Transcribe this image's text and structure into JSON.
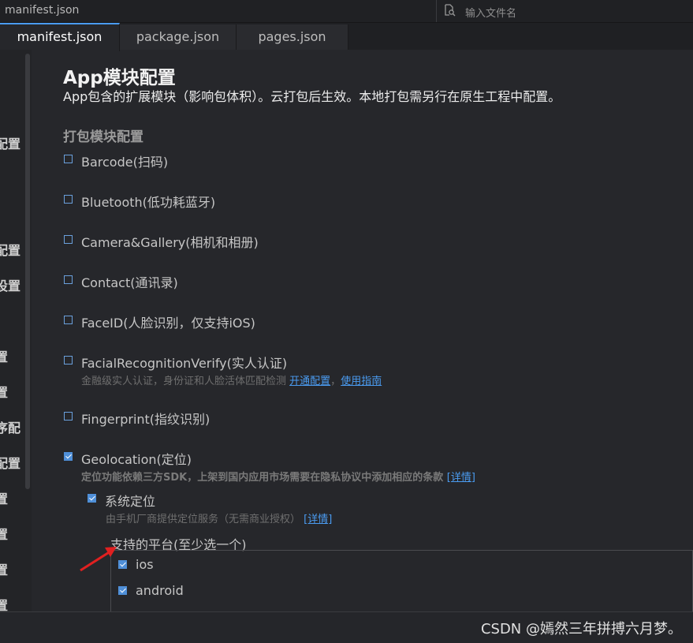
{
  "window": {
    "filename": "manifest.json",
    "search_placeholder": "输入文件名",
    "search_icon": "file-search-icon"
  },
  "tabs": [
    {
      "label": "manifest.json",
      "active": true
    },
    {
      "label": "package.json",
      "active": false
    },
    {
      "label": "pages.json",
      "active": false
    }
  ],
  "sidebar": {
    "items": [
      "配置",
      "配置",
      "设置",
      "置",
      "置",
      "序配",
      "配置",
      "置",
      "置",
      "置",
      "置"
    ]
  },
  "main": {
    "title": "App模块配置",
    "description": "App包含的扩展模块（影响包体积）。云打包后生效。本地打包需另行在原生工程中配置。",
    "section_title": "打包模块配置",
    "options": [
      {
        "label": "Barcode(扫码)",
        "checked": false
      },
      {
        "label": "Bluetooth(低功耗蓝牙)",
        "checked": false
      },
      {
        "label": "Camera&Gallery(相机和相册)",
        "checked": false
      },
      {
        "label": "Contact(通讯录)",
        "checked": false
      },
      {
        "label": "FaceID(人脸识别，仅支持iOS)",
        "checked": false
      },
      {
        "label": "FacialRecognitionVerify(实人认证)",
        "checked": false,
        "note": "金融级实人认证，身份证和人脸活体匹配检测",
        "link1": "开通配置",
        "sep": "，",
        "link2": "使用指南"
      },
      {
        "label": "Fingerprint(指纹识别)",
        "checked": false
      },
      {
        "label": "Geolocation(定位)",
        "checked": true,
        "note": "定位功能依赖三方SDK，上架到国内应用市场需要在隐私协议中添加相应的条款",
        "link": "[详情]"
      }
    ],
    "sub_option": {
      "label": "系统定位",
      "checked": true,
      "note": "由手机厂商提供定位服务（无需商业授权）",
      "link": "[详情]"
    },
    "platforms": {
      "title": "支持的平台(至少选一个)",
      "items": [
        {
          "label": "ios",
          "checked": true
        },
        {
          "label": "android",
          "checked": true
        }
      ]
    }
  },
  "watermark": "CSDN @嫣然三年拼搏六月梦。",
  "colors": {
    "accent": "#4a9bf0",
    "checkbox": "#4f8fd8",
    "arrow": "#e02020"
  }
}
